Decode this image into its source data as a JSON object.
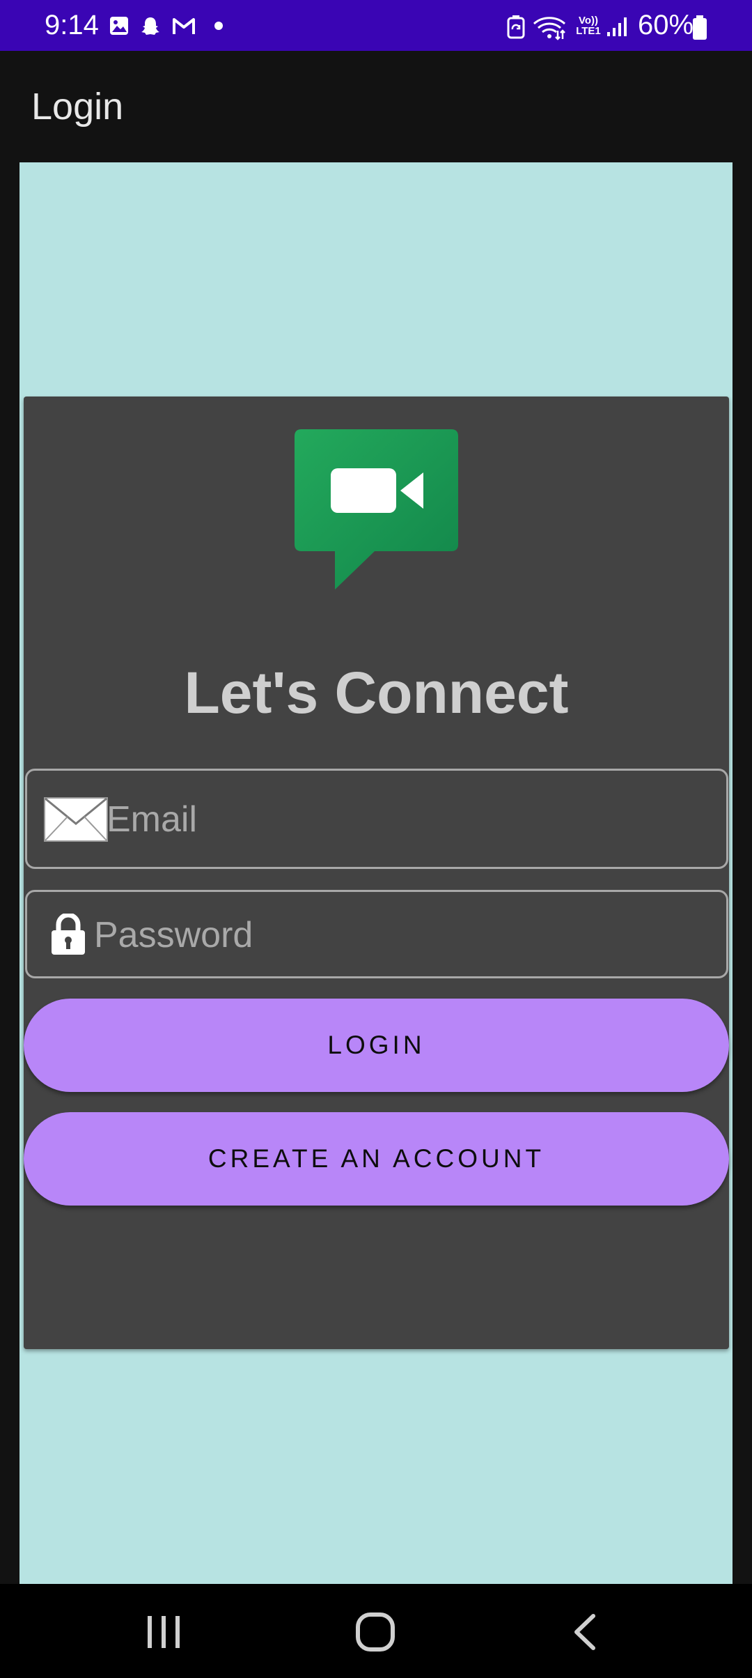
{
  "status_bar": {
    "time": "9:14",
    "network_label_top": "Vo))",
    "network_label_bottom": "LTE1",
    "battery_percent": "60%",
    "icons": [
      "gallery-icon",
      "snapchat-icon",
      "gmail-icon",
      "notification-dot-icon",
      "battery-saver-icon",
      "wifi-icon",
      "signal-icon",
      "battery-icon"
    ]
  },
  "app_bar": {
    "title": "Login"
  },
  "card": {
    "heading": "Let's Connect",
    "logo": "video-chat-icon",
    "email": {
      "placeholder": "Email",
      "value": "",
      "icon": "envelope-icon"
    },
    "password": {
      "placeholder": "Password",
      "value": "",
      "icon": "lock-icon"
    },
    "login_label": "LOGIN",
    "create_label": "CREATE AN ACCOUNT"
  },
  "nav_bar": {
    "icons": [
      "recent-apps-icon",
      "home-icon",
      "back-icon"
    ]
  },
  "colors": {
    "status_bar": "#3a05b4",
    "app_bar": "#121212",
    "content_background": "#b7e3e2",
    "card": "#434343",
    "button": "#b886f8",
    "logo_green": "#1e9e55"
  }
}
